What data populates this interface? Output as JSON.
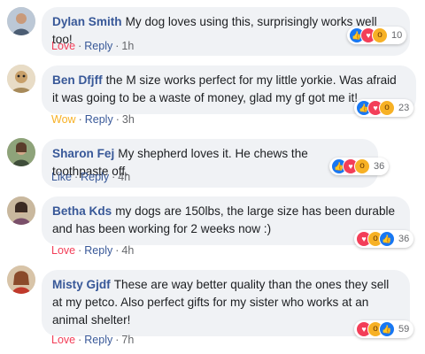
{
  "comments": [
    {
      "author": "Dylan Smith",
      "text": "My dog loves using this, surprisingly works well too!",
      "reaction_label": "Love",
      "reply_label": "Reply",
      "time": "1h",
      "reaction_icons": [
        "like-icon",
        "love-icon",
        "wow-icon"
      ],
      "reaction_count": "10"
    },
    {
      "author": "Ben Dfjff",
      "text": "the M size works perfect for my little yorkie. Was afraid it was going to be a waste of money, glad my gf got me it!",
      "reaction_label": "Wow",
      "reply_label": "Reply",
      "time": "3h",
      "reaction_icons": [
        "like-icon",
        "love-icon",
        "wow-icon"
      ],
      "reaction_count": "23"
    },
    {
      "author": "Sharon Fej",
      "text": "My shepherd loves it. He chews the toothpaste off.",
      "reaction_label": "Like",
      "reply_label": "Reply",
      "time": "4h",
      "reaction_icons": [
        "like-icon",
        "love-icon",
        "wow-icon"
      ],
      "reaction_count": "36"
    },
    {
      "author": "Betha Kds",
      "text": "my dogs are 150lbs, the large size has been durable and has been working for 2 weeks now :)",
      "reaction_label": "Love",
      "reply_label": "Reply",
      "time": "4h",
      "reaction_icons": [
        "love-icon",
        "wow-icon",
        "like-icon"
      ],
      "reaction_count": "36"
    },
    {
      "author": "Misty Gjdf",
      "text": "These are way better quality than the ones they sell at my petco. Also perfect gifts for my sister who works at an animal shelter!",
      "reaction_label": "Love",
      "reply_label": "Reply",
      "time": "7h",
      "reaction_icons": [
        "love-icon",
        "wow-icon",
        "like-icon"
      ],
      "reaction_count": "59"
    }
  ],
  "colors": {
    "author": "#385898",
    "love": "#f33e58",
    "wow": "#f7b125",
    "like": "#1877f2",
    "bubble": "#f0f2f5",
    "meta": "#65676b"
  }
}
